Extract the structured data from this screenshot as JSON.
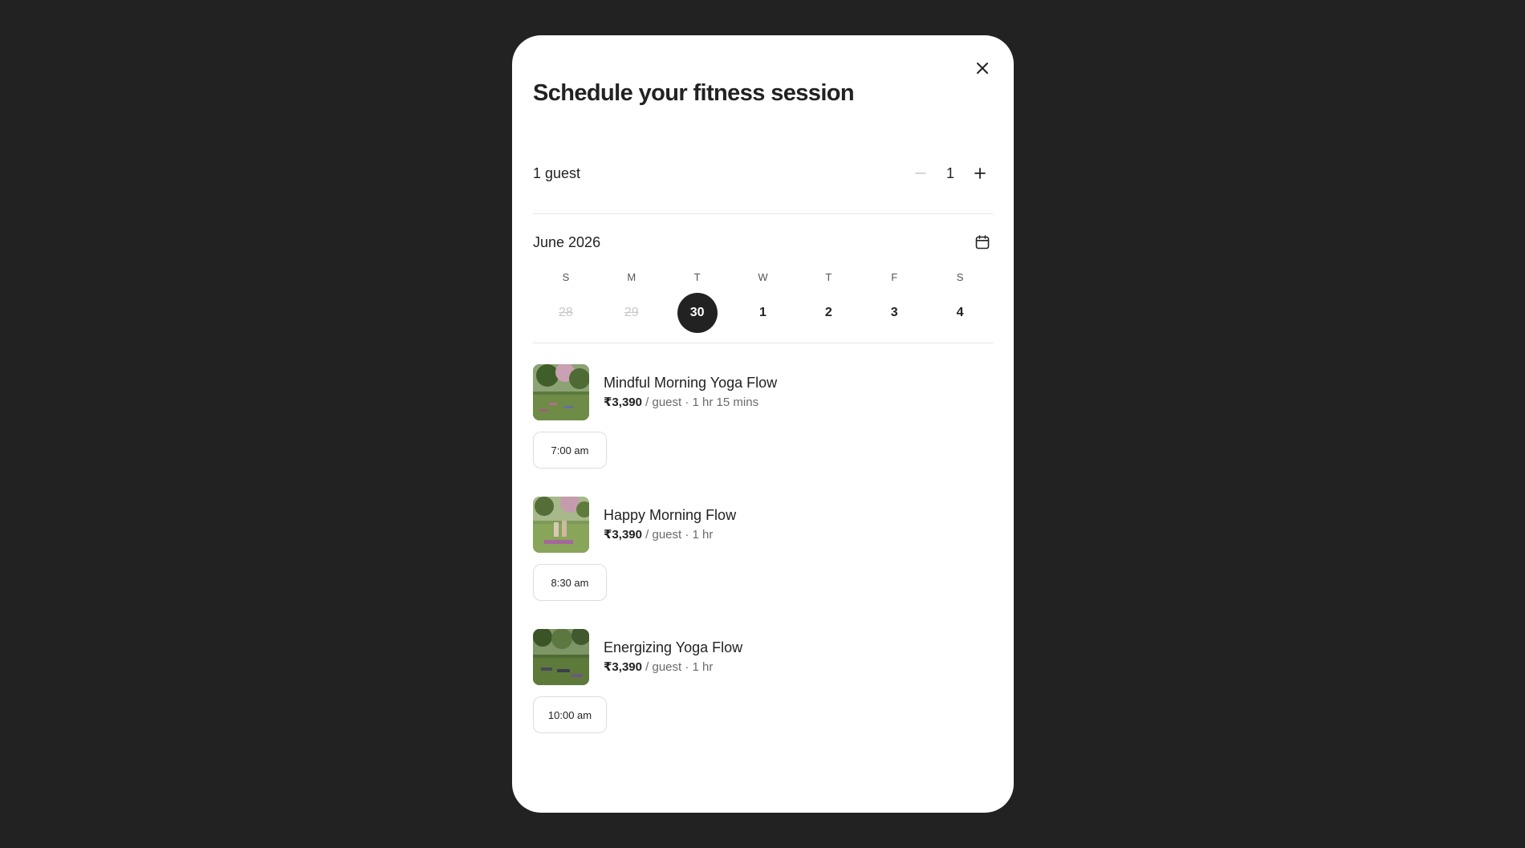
{
  "modal": {
    "title": "Schedule your fitness session"
  },
  "guests": {
    "label": "1 guest",
    "count": "1"
  },
  "calendar": {
    "month": "June 2026",
    "weekdays": [
      "S",
      "M",
      "T",
      "W",
      "T",
      "F",
      "S"
    ],
    "days": [
      {
        "label": "28",
        "state": "disabled"
      },
      {
        "label": "29",
        "state": "disabled"
      },
      {
        "label": "30",
        "state": "selected"
      },
      {
        "label": "1",
        "state": "available"
      },
      {
        "label": "2",
        "state": "available"
      },
      {
        "label": "3",
        "state": "available"
      },
      {
        "label": "4",
        "state": "available"
      }
    ]
  },
  "sessions": [
    {
      "name": "Mindful Morning Yoga Flow",
      "price": "₹3,390",
      "per": " / guest",
      "separator": "·",
      "duration": "1 hr 15 mins",
      "time": "7:00 am"
    },
    {
      "name": "Happy Morning Flow",
      "price": "₹3,390",
      "per": " / guest",
      "separator": "·",
      "duration": "1 hr",
      "time": "8:30 am"
    },
    {
      "name": "Energizing Yoga Flow",
      "price": "₹3,390",
      "per": " / guest",
      "separator": "·",
      "duration": "1 hr",
      "time": "10:00 am"
    }
  ],
  "icons": {
    "close": "close-icon",
    "minus": "minus-icon",
    "plus": "plus-icon",
    "calendar": "calendar-icon"
  },
  "colors": {
    "backdrop": "#222222",
    "surface": "#ffffff",
    "text": "#222222",
    "muted": "#6a6a6a",
    "selected_day": "#222222",
    "disabled_day": "#c8c8c8",
    "divider": "#e4e4e4"
  }
}
